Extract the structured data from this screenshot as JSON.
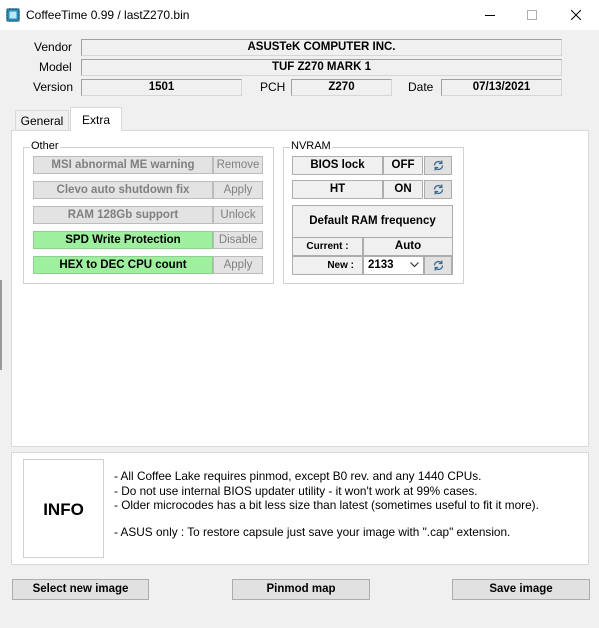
{
  "window": {
    "title": "CoffeeTime 0.99  /  lastZ270.bin",
    "icon": "coffeetime-app-icon"
  },
  "header": {
    "vendor_label": "Vendor",
    "vendor_value": "ASUSTeK COMPUTER INC.",
    "model_label": "Model",
    "model_value": "TUF Z270 MARK 1",
    "version_label": "Version",
    "version_value": "1501",
    "pch_label": "PCH",
    "pch_value": "Z270",
    "date_label": "Date",
    "date_value": "07/13/2021"
  },
  "tabs": [
    {
      "label": "General",
      "active": false
    },
    {
      "label": "Extra",
      "active": true
    }
  ],
  "other": {
    "title": "Other",
    "rows": [
      {
        "label": "MSI abnormal ME warning",
        "action": "Remove",
        "enabled": false
      },
      {
        "label": "Clevo auto shutdown fix",
        "action": "Apply",
        "enabled": false
      },
      {
        "label": "RAM 128Gb support",
        "action": "Unlock",
        "enabled": false
      },
      {
        "label": "SPD Write Protection",
        "action": "Disable",
        "enabled": true
      },
      {
        "label": "HEX to DEC CPU count",
        "action": "Apply",
        "enabled": true
      }
    ]
  },
  "nvram": {
    "title": "NVRAM",
    "bios_lock_label": "BIOS lock",
    "bios_lock_value": "OFF",
    "ht_label": "HT",
    "ht_value": "ON",
    "ram_title": "Default RAM frequency",
    "current_label": "Current :",
    "current_value": "Auto",
    "new_label": "New :",
    "new_value": "2133",
    "refresh_icon": "refresh-icon"
  },
  "info": {
    "box_label": "INFO",
    "lines": [
      "- All Coffee Lake requires pinmod, except B0 rev. and any 1440 CPUs.",
      "- Do not use internal BIOS updater utility - it won't work at 99% cases.",
      "- Older microcodes has a bit less size than latest (sometimes useful to fit it more).",
      "- ASUS only : To restore capsule just save your image with \".cap\" extension."
    ]
  },
  "buttons": {
    "select_new_image": "Select new image",
    "pinmod_map": "Pinmod map",
    "save_image": "Save image"
  },
  "colors": {
    "enabled_green": "#9ef09e",
    "disabled_gray": "#e3e3e3"
  }
}
